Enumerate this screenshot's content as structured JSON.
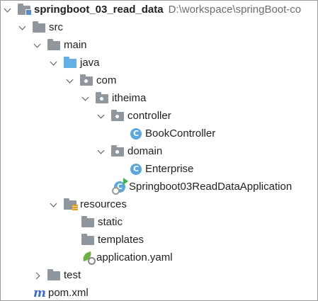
{
  "tree": {
    "root": {
      "name": "springboot_03_read_data",
      "path": "D:\\workspace\\springBoot-co"
    },
    "src": "src",
    "main": "main",
    "java": "java",
    "com": "com",
    "itheima": "itheima",
    "controller": "controller",
    "book_controller": "BookController",
    "domain": "domain",
    "enterprise": "Enterprise",
    "application_class": "Springboot03ReadDataApplication",
    "resources": "resources",
    "static": "static",
    "templates": "templates",
    "application_yaml": "application.yaml",
    "test": "test",
    "pom": "pom.xml"
  },
  "icons": {
    "class": "C",
    "maven": "m"
  },
  "colors": {
    "folder": "#8f969d",
    "source_folder": "#63b0e6",
    "class_icon": "#5aa7de",
    "spring": "#6db33f",
    "maven": "#3d6bd1"
  }
}
